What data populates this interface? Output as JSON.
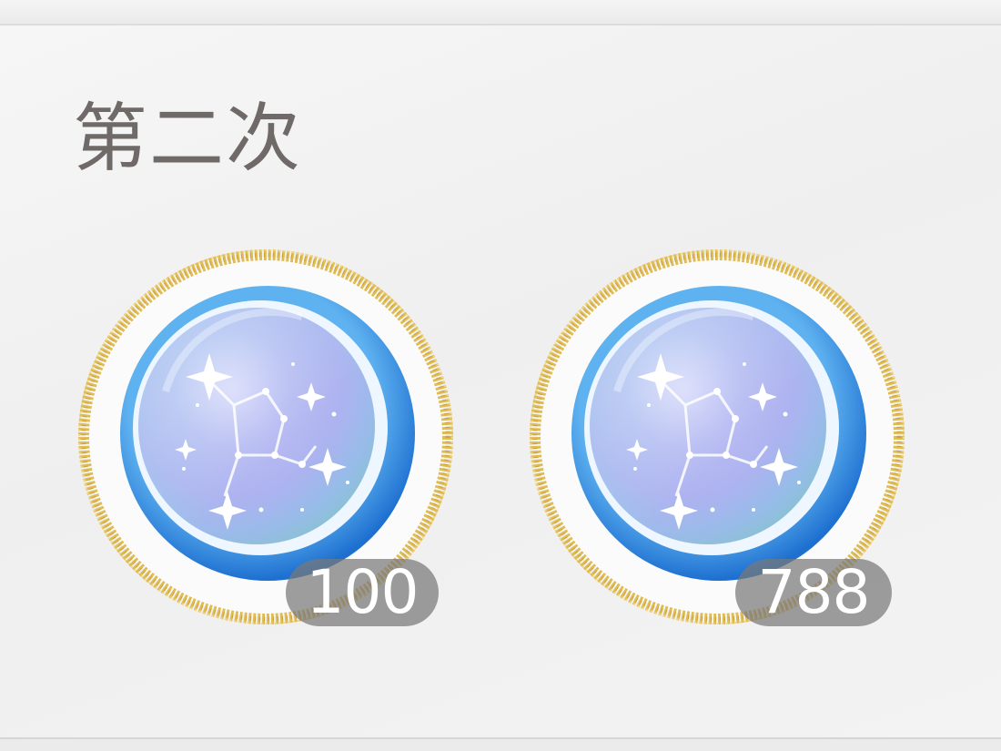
{
  "section": {
    "title": "第二次"
  },
  "rewards": [
    {
      "icon": "constellation-coin-icon",
      "count": "100"
    },
    {
      "icon": "constellation-coin-icon",
      "count": "788"
    }
  ],
  "colors": {
    "title_text": "#6f6a68",
    "gold_ring": "#d9b24a",
    "coin_blue": "#3a8fe0",
    "badge_bg": "#787878",
    "badge_text": "#ffffff"
  }
}
